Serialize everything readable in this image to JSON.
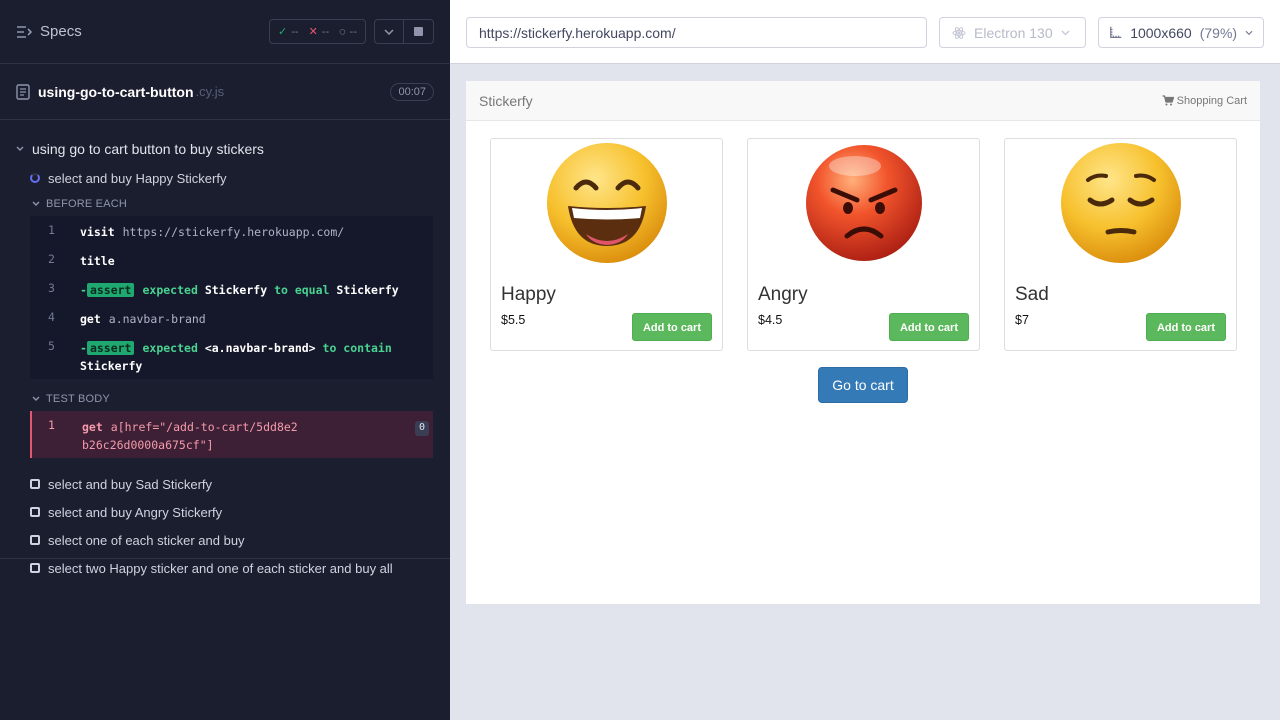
{
  "reporter": {
    "specs_label": "Specs",
    "stats": {
      "passed": "--",
      "failed": "--",
      "pending": "--"
    },
    "spec": {
      "name": "using-go-to-cart-button",
      "ext": ".cy.js",
      "duration": "00:07"
    },
    "suite_title": "using go to cart button to buy stickers",
    "running_test": "select and buy Happy Stickerfy",
    "before_each_label": "BEFORE EACH",
    "before_each": [
      {
        "num": "1",
        "name": "visit",
        "arg": "https://stickerfy.herokuapp.com/"
      },
      {
        "num": "2",
        "name": "title",
        "arg": ""
      },
      {
        "num": "3",
        "prefix": "-",
        "name": "assert",
        "parts": [
          "expected",
          "Stickerfy",
          "to equal",
          "Stickerfy"
        ]
      },
      {
        "num": "4",
        "name": "get",
        "arg": "a.navbar-brand"
      },
      {
        "num": "5",
        "prefix": "-",
        "name": "assert",
        "parts": [
          "expected",
          "<a.navbar-brand>",
          "to contain",
          "Stickerfy"
        ]
      }
    ],
    "test_body_label": "TEST BODY",
    "test_body": [
      {
        "num": "1",
        "name": "get",
        "arg": "a[href=\"/add-to-cart/5dd8e2b26c26d0000a675cf\"]",
        "count": "0"
      }
    ],
    "other_tests": [
      "select and buy Sad Stickerfy",
      "select and buy Angry Stickerfy",
      "select one of each sticker and buy",
      "select two Happy sticker and one of each sticker and buy all"
    ]
  },
  "aut": {
    "url": "https://stickerfy.herokuapp.com/",
    "browser": "Electron 130",
    "viewport": "1000x660",
    "zoom": "(79%)"
  },
  "site": {
    "brand": "Stickerfy",
    "cart_link": "Shopping Cart",
    "products": [
      {
        "title": "Happy",
        "price": "$5.5",
        "button": "Add to cart",
        "emoji": "happy-face"
      },
      {
        "title": "Angry",
        "price": "$4.5",
        "button": "Add to cart",
        "emoji": "angry-face"
      },
      {
        "title": "Sad",
        "price": "$7",
        "button": "Add to cart",
        "emoji": "sad-face"
      }
    ],
    "go_to_cart": "Go to cart"
  },
  "colors": {
    "reporter_bg": "#1b1e2e",
    "pass": "#1fa971",
    "fail": "#e45770",
    "running": "#6470f3",
    "add_btn": "#5cb85c",
    "go_cart_btn": "#337ab7"
  }
}
